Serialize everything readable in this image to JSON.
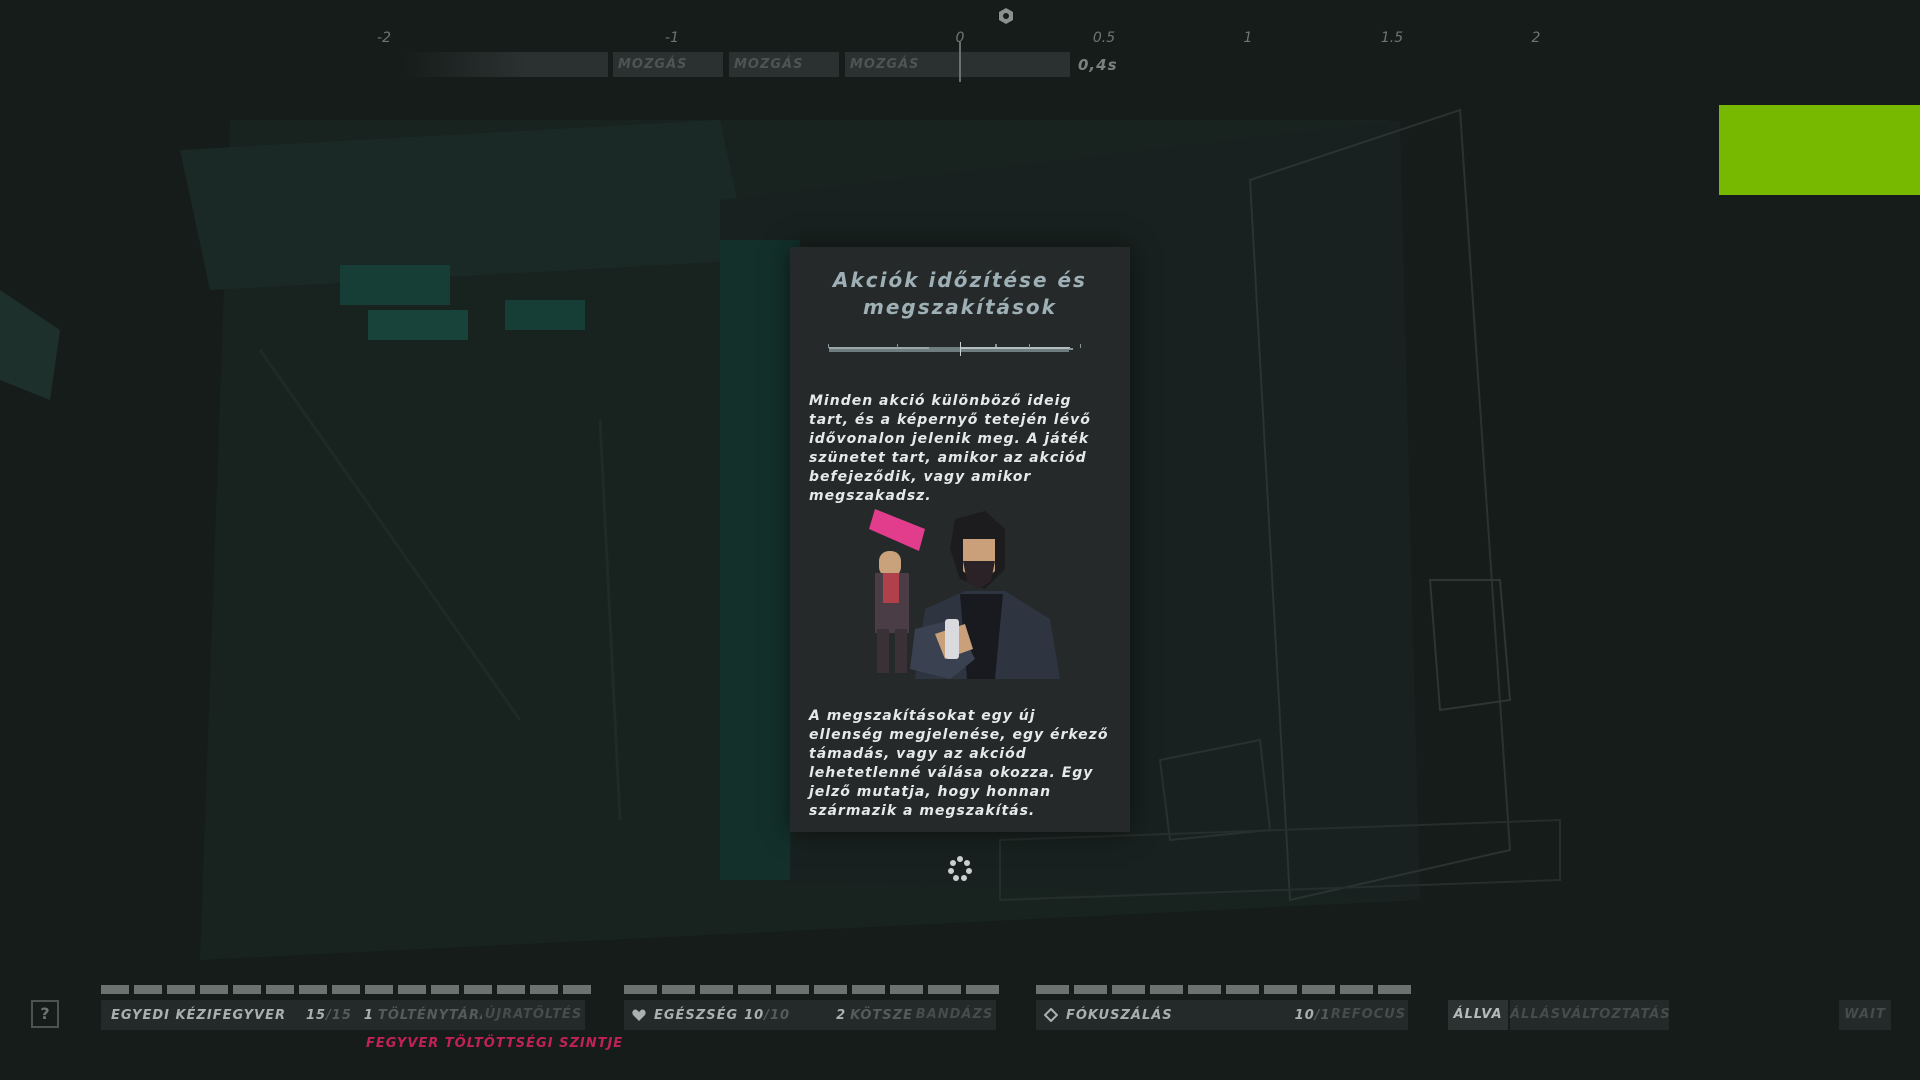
{
  "timeline": {
    "ticks": [
      "-2",
      "-1",
      "0",
      "0.5",
      "1",
      "1.5",
      "2"
    ],
    "segments": [
      {
        "label": ""
      },
      {
        "label": "MOZGÁS"
      },
      {
        "label": "MOZGÁS"
      },
      {
        "label": "MOZGÁS"
      }
    ],
    "time": "0,4s"
  },
  "tutorial": {
    "title_line1": "Akciók időzítése és",
    "title_line2": "megszakítások",
    "paragraph1": "Minden akció különböző ideig tart, és a képernyő tetején lévő idővonalon jelenik meg. A játék szünetet tart, amikor az akciód befejeződik, vagy amikor megszakadsz.",
    "paragraph2": "A megszakításokat egy új ellenség megjelenése, egy érkező támadás, vagy az akciód lehetetlenné válása okozza. Egy jelző mutatja, hogy honnan származik a megszakítás."
  },
  "hud": {
    "help_label": "?",
    "weapon": {
      "name": "EGYEDI KÉZIFEGYVER",
      "ammo": "15",
      "ammo_max": "/15",
      "mags_count": "1",
      "mags_label": "TÖLTÉNYTÁRAK",
      "reload_label": "ÚJRATÖLTÉS",
      "ammo_pips": 15,
      "fill_label": "FEGYVER TÖLTÖTTSÉGI SZINTJE"
    },
    "health": {
      "label": "EGÉSZSÉG",
      "value": "10",
      "max": "/10",
      "bandage_count": "2",
      "bandage_label": "KÖTSZEREK",
      "bandage_action": "BANDÁZS",
      "pips": 10
    },
    "focus": {
      "label": "FÓKUSZÁLÁS",
      "value": "10",
      "max": "/10",
      "refocus_label": "REFOCUS",
      "pips": 10
    },
    "stance": {
      "current": "ÁLLVA",
      "change_label": "ÁLLÁSVÁLTOZTATÁS"
    },
    "wait_label": "WAIT"
  },
  "colors": {
    "accent_green": "#76b900",
    "interrupt_magenta": "#c02257",
    "panel_bg": "#25292a"
  }
}
